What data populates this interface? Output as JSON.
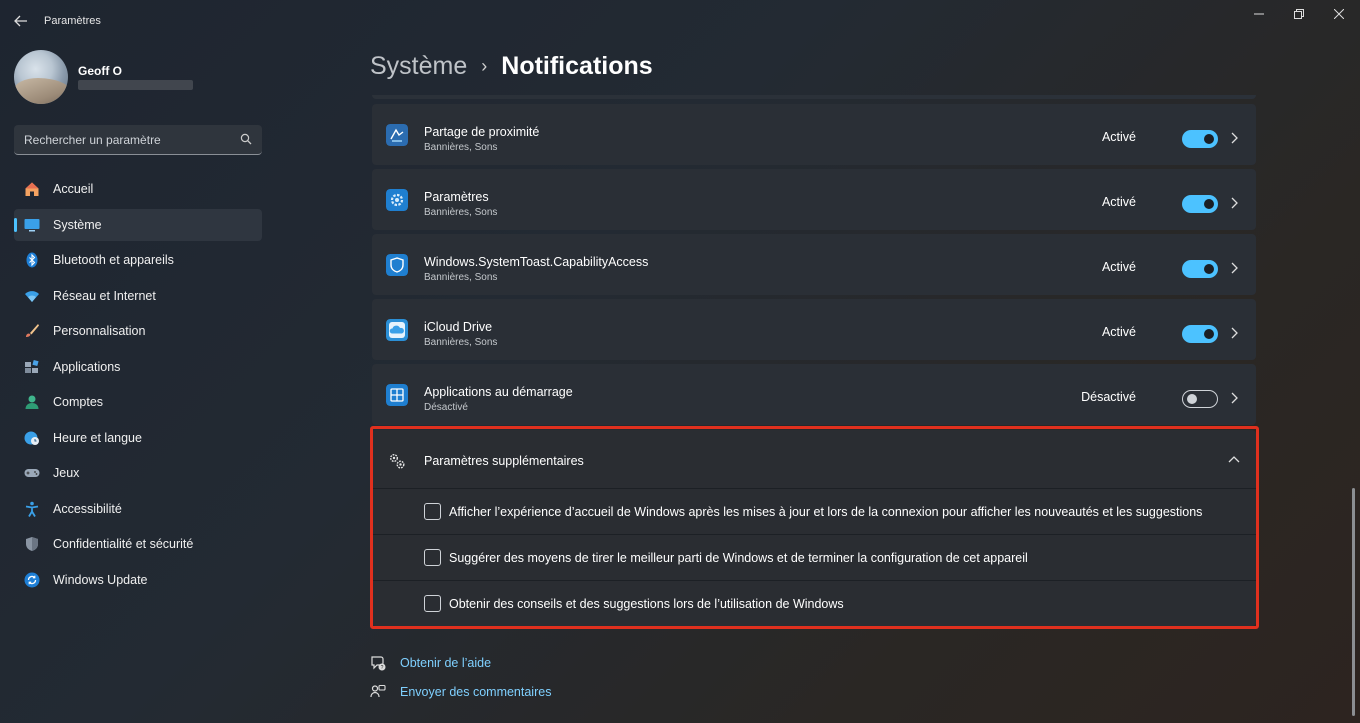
{
  "window": {
    "title": "Paramètres"
  },
  "user": {
    "name": "Geoff O"
  },
  "search": {
    "placeholder": "Rechercher un paramètre"
  },
  "sidebar": {
    "items": [
      {
        "label": "Accueil",
        "icon": "home-icon"
      },
      {
        "label": "Système",
        "icon": "system-icon",
        "active": true
      },
      {
        "label": "Bluetooth et appareils",
        "icon": "bluetooth-icon"
      },
      {
        "label": "Réseau et Internet",
        "icon": "network-icon"
      },
      {
        "label": "Personnalisation",
        "icon": "brush-icon"
      },
      {
        "label": "Applications",
        "icon": "apps-icon"
      },
      {
        "label": "Comptes",
        "icon": "account-icon"
      },
      {
        "label": "Heure et langue",
        "icon": "clock-globe-icon"
      },
      {
        "label": "Jeux",
        "icon": "gamepad-icon"
      },
      {
        "label": "Accessibilité",
        "icon": "accessibility-icon"
      },
      {
        "label": "Confidentialité et sécurité",
        "icon": "shield-icon"
      },
      {
        "label": "Windows Update",
        "icon": "update-icon"
      }
    ]
  },
  "breadcrumb": {
    "parent": "Système",
    "separator": "›",
    "current": "Notifications"
  },
  "apps": [
    {
      "name": "Partage de proximité",
      "sub": "Bannières, Sons",
      "state": "Activé",
      "on": true,
      "icon": "nearby-share-icon"
    },
    {
      "name": "Paramètres",
      "sub": "Bannières, Sons",
      "state": "Activé",
      "on": true,
      "icon": "settings-gear-icon"
    },
    {
      "name": "Windows.SystemToast.CapabilityAccess",
      "sub": "Bannières, Sons",
      "state": "Activé",
      "on": true,
      "icon": "capability-shield-icon"
    },
    {
      "name": "iCloud Drive",
      "sub": "Bannières, Sons",
      "state": "Activé",
      "on": true,
      "icon": "icloud-icon"
    },
    {
      "name": "Applications au démarrage",
      "sub": "Désactivé",
      "state": "Désactivé",
      "on": false,
      "icon": "startup-apps-icon"
    }
  ],
  "additional": {
    "title": "Paramètres supplémentaires",
    "options": [
      {
        "label": "Afficher l’expérience d’accueil de Windows après les mises à jour et lors de la connexion pour afficher les nouveautés et les suggestions",
        "checked": false
      },
      {
        "label": "Suggérer des moyens de tirer le meilleur parti de Windows et de terminer la configuration de cet appareil",
        "checked": false
      },
      {
        "label": "Obtenir des conseils et des suggestions lors de l’utilisation de Windows",
        "checked": false
      }
    ]
  },
  "footer": {
    "help": "Obtenir de l’aide",
    "feedback": "Envoyer des commentaires"
  },
  "colors": {
    "accent": "#4cc2ff",
    "highlight": "#e0301e",
    "link": "#7fd0ff"
  }
}
